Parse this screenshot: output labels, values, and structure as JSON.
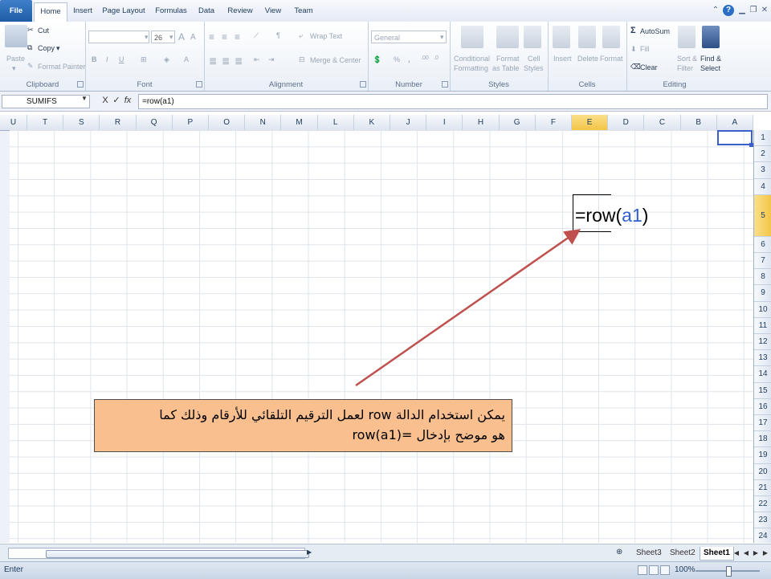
{
  "tabs": [
    "File",
    "Home",
    "Insert",
    "Page Layout",
    "Formulas",
    "Data",
    "Review",
    "View",
    "Team"
  ],
  "ribbon": {
    "clipboard": {
      "paste": "Paste",
      "cut": "Cut",
      "copy": "Copy",
      "format_painter": "Format Painter",
      "label": "Clipboard"
    },
    "font": {
      "size": "26",
      "bold": "B",
      "italic": "I",
      "underline": "U",
      "grow": "A",
      "shrink": "A",
      "label": "Font"
    },
    "alignment": {
      "wrap_text": "Wrap Text",
      "merge_center": "Merge & Center",
      "label": "Alignment"
    },
    "number": {
      "format": "General",
      "percent": "%",
      "comma": ",",
      "label": "Number"
    },
    "styles": {
      "conditional": "Conditional",
      "conditional2": "Formatting",
      "format_as": "Format",
      "format_as2": "as Table",
      "cell_styles": "Cell",
      "cell_styles2": "Styles",
      "label": "Styles"
    },
    "cells": {
      "insert": "Insert",
      "delete": "Delete",
      "format": "Format",
      "label": "Cells"
    },
    "editing": {
      "autosum": "AutoSum",
      "fill": "Fill",
      "clear": "Clear",
      "sort": "Sort &",
      "sort2": "Filter",
      "find": "Find &",
      "find2": "Select",
      "label": "Editing"
    }
  },
  "formula_bar": {
    "name_box": "SUMIFS",
    "cancel": "X",
    "enter": "✓",
    "fx": "fx",
    "value": "=row(a1)"
  },
  "columns": [
    "U",
    "T",
    "S",
    "R",
    "Q",
    "P",
    "O",
    "N",
    "M",
    "L",
    "K",
    "J",
    "I",
    "H",
    "G",
    "F",
    "E",
    "D",
    "C",
    "B",
    "A"
  ],
  "rows": [
    "1",
    "2",
    "3",
    "4",
    "5",
    "6",
    "7",
    "8",
    "9",
    "10",
    "11",
    "12",
    "13",
    "14",
    "15",
    "16",
    "17",
    "18",
    "19",
    "20",
    "21",
    "22",
    "23",
    "24"
  ],
  "selected_column": "E",
  "selected_row": "5",
  "cell_formula": {
    "prefix": "=row(",
    "ref": "a1",
    "suffix": ")"
  },
  "callout": {
    "line1": "يمكن استخدام الدالة row لعمل الترقيم التلقائي للأرقام وذلك كما",
    "line2": "هو موضح بإدخال =row(a1)"
  },
  "sheets": [
    "Sheet3",
    "Sheet2",
    "Sheet1"
  ],
  "active_sheet": "Sheet1",
  "status": {
    "mode": "Enter",
    "zoom": "100%"
  }
}
